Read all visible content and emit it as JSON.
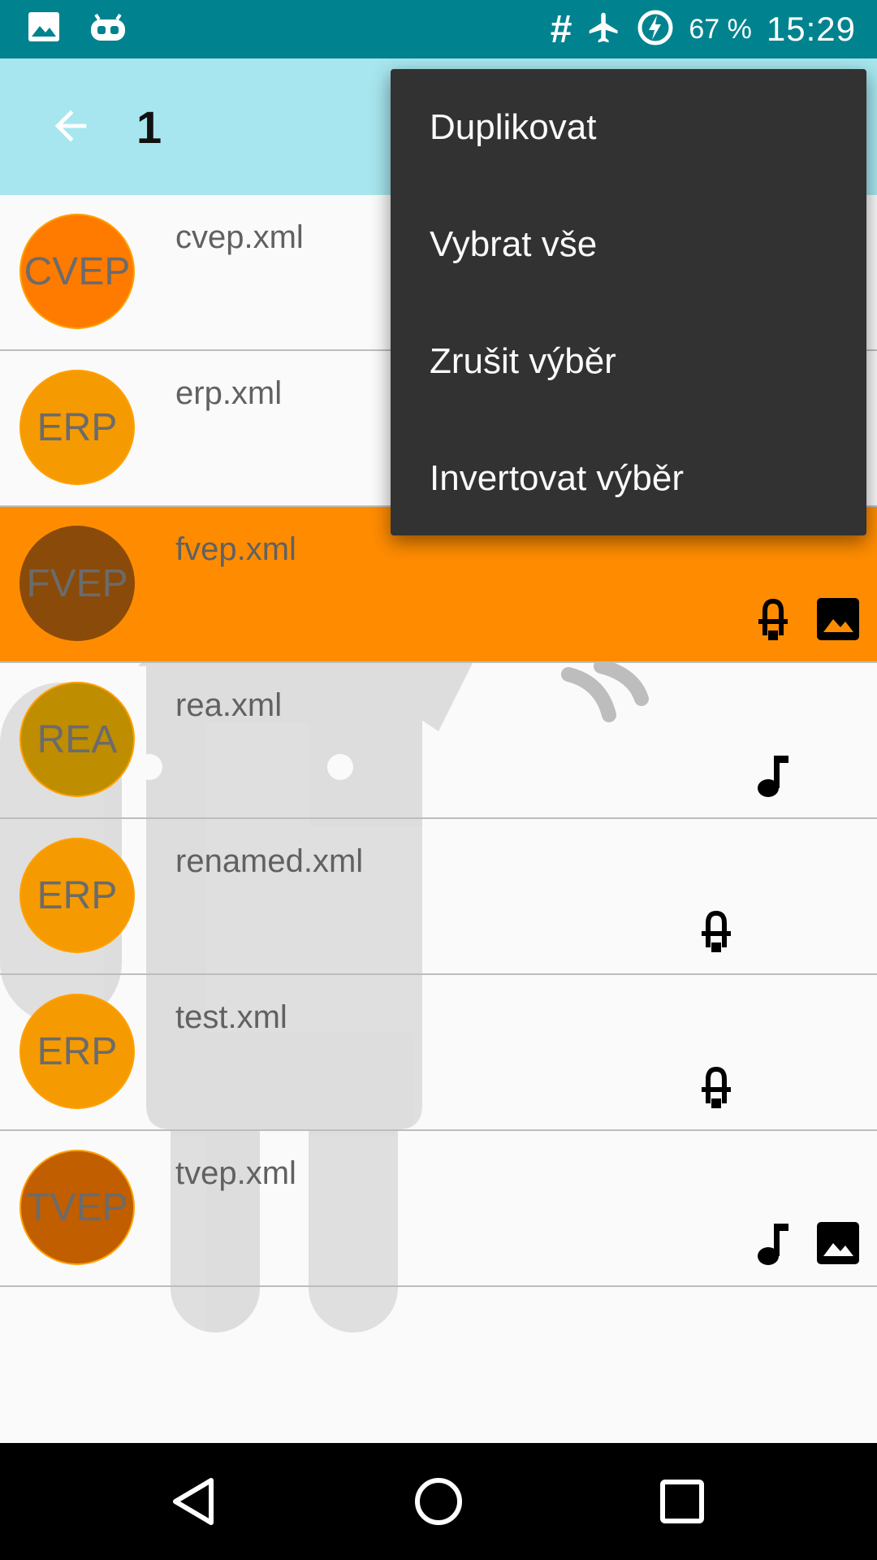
{
  "status_bar": {
    "battery_percent": "67 %",
    "time": "15:29",
    "left_icons": [
      "image-icon",
      "robot-icon"
    ],
    "right_icons": [
      "hash-icon",
      "airplane-icon",
      "battery-charging-icon"
    ]
  },
  "toolbar": {
    "title": "1",
    "back_icon": "arrow-back-icon"
  },
  "files": [
    {
      "name": "cvep.xml",
      "avatar": "CVEP",
      "avatar_color": "#ff7b00",
      "selected": false,
      "icons": []
    },
    {
      "name": "erp.xml",
      "avatar": "ERP",
      "avatar_color": "#f59a00",
      "selected": false,
      "icons": []
    },
    {
      "name": "fvep.xml",
      "avatar": "FVEP",
      "avatar_color": "#8a4a0a",
      "selected": true,
      "icons": [
        "plug-icon",
        "image-icon"
      ]
    },
    {
      "name": "rea.xml",
      "avatar": "REA",
      "avatar_color": "#bf8d00",
      "selected": false,
      "icons": [
        "music-note-icon"
      ]
    },
    {
      "name": "renamed.xml",
      "avatar": "ERP",
      "avatar_color": "#f59a00",
      "selected": false,
      "icons": [
        "plug-icon"
      ]
    },
    {
      "name": "test.xml",
      "avatar": "ERP",
      "avatar_color": "#f59a00",
      "selected": false,
      "icons": [
        "plug-icon"
      ]
    },
    {
      "name": "tvep.xml",
      "avatar": "TVEP",
      "avatar_color": "#c15e00",
      "selected": false,
      "icons": [
        "music-note-icon",
        "image-icon"
      ]
    }
  ],
  "menu": {
    "items": [
      "Duplikovat",
      "Vybrat vše",
      "Zrušit výběr",
      "Invertovat výběr"
    ]
  },
  "colors": {
    "status_bar": "#00838f",
    "toolbar": "#a7e6ee",
    "selected_row": "#ff8c00",
    "menu_bg": "#323232"
  }
}
